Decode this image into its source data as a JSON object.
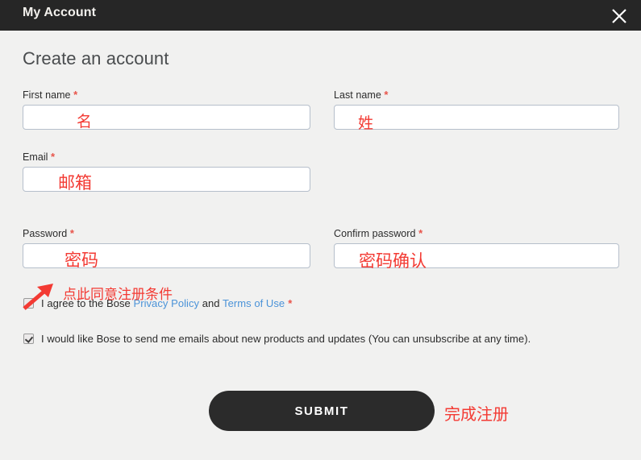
{
  "window": {
    "title": "My Account",
    "close_icon": "close-icon"
  },
  "page": {
    "heading": "Create an account"
  },
  "colors": {
    "header_bg": "#262626",
    "page_bg": "#f1f1f0",
    "required_red": "#e8544a",
    "annotation_red": "#f33a33",
    "link_blue": "#4b93d8",
    "submit_bg": "#2b2b2b",
    "input_border": "#b6bfcb"
  },
  "form": {
    "fields": [
      {
        "name": "first-name",
        "label": "First name",
        "required": "*",
        "value": "",
        "placeholder": "",
        "annotation": "名"
      },
      {
        "name": "last-name",
        "label": "Last name",
        "required": "*",
        "value": "",
        "placeholder": "",
        "annotation": "姓"
      },
      {
        "name": "email",
        "label": "Email",
        "required": "*",
        "value": "",
        "placeholder": "",
        "annotation": "邮箱"
      },
      {
        "name": "password",
        "label": "Password",
        "required": "*",
        "value": "",
        "placeholder": "",
        "annotation": "密码"
      },
      {
        "name": "confirm-password",
        "label": "Confirm password",
        "required": "*",
        "value": "",
        "placeholder": "",
        "annotation": "密码确认"
      }
    ],
    "terms_checkbox": {
      "checked": false,
      "text_before": "I agree to the Bose ",
      "link1": "Privacy Policy",
      "text_middle": " and ",
      "link2": "Terms of Use",
      "required": "*",
      "annotation": "点此同意注册条件"
    },
    "marketing_checkbox": {
      "checked": true,
      "text": "I would like Bose to send me emails about new products and updates (You can unsubscribe at any time)."
    },
    "submit": {
      "label": "SUBMIT",
      "annotation": "完成注册"
    }
  }
}
